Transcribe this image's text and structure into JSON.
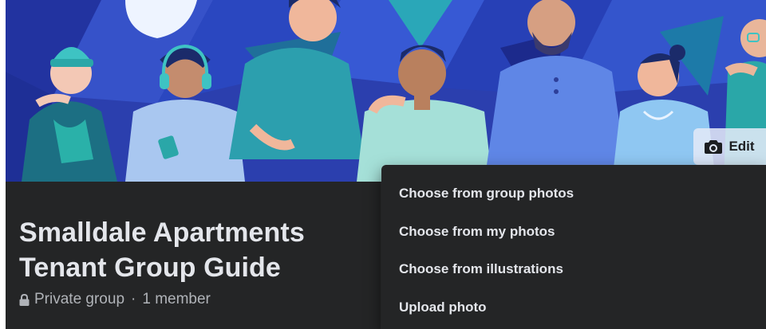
{
  "cover": {
    "edit_label": "Edit",
    "edit_icon": "camera-icon"
  },
  "group": {
    "title_line1": "Smalldale Apartments",
    "title_line2": "Tenant Group Guide",
    "privacy": "Private group",
    "separator": "·",
    "members": "1 member",
    "privacy_icon": "lock-icon"
  },
  "menu": {
    "items": [
      {
        "label": "Choose from group photos"
      },
      {
        "label": "Choose from my photos"
      },
      {
        "label": "Choose from illustrations"
      },
      {
        "label": "Upload photo"
      }
    ]
  },
  "colors": {
    "background": "#242526",
    "text_primary": "#e4e6eb",
    "text_secondary": "#b0b3b8",
    "cover_base": "#2a3ea8"
  }
}
